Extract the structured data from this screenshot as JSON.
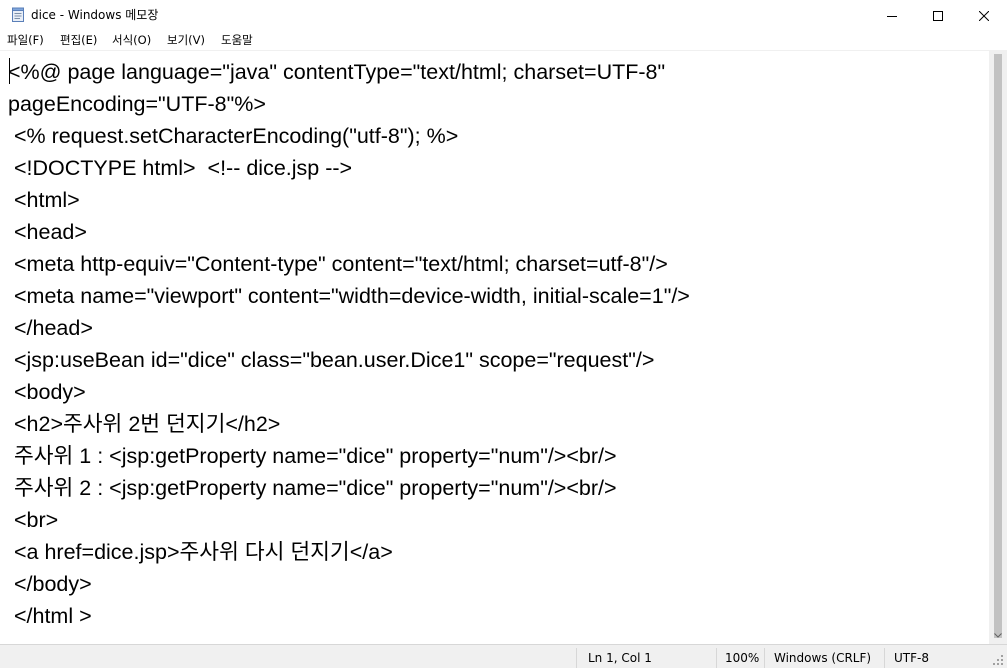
{
  "window": {
    "title": "dice - Windows 메모장"
  },
  "menu": {
    "file": "파일(F)",
    "edit": "편집(E)",
    "format": "서식(O)",
    "view": "보기(V)",
    "help": "도움말"
  },
  "editor": {
    "content": "<%@ page language=\"java\" contentType=\"text/html; charset=UTF-8\"\npageEncoding=\"UTF-8\"%>\n <% request.setCharacterEncoding(\"utf-8\"); %>\n <!DOCTYPE html>  <!-- dice.jsp -->\n <html>\n <head>\n <meta http-equiv=\"Content-type\" content=\"text/html; charset=utf-8\"/>\n <meta name=\"viewport\" content=\"width=device-width, initial-scale=1\"/>\n </head>\n <jsp:useBean id=\"dice\" class=\"bean.user.Dice1\" scope=\"request\"/>\n <body>\n <h2>주사위 2번 던지기</h2>\n 주사위 1 : <jsp:getProperty name=\"dice\" property=\"num\"/><br/>\n 주사위 2 : <jsp:getProperty name=\"dice\" property=\"num\"/><br/>\n <br>\n <a href=dice.jsp>주사위 다시 던지기</a>\n </body>\n </html >"
  },
  "status": {
    "position": "Ln 1, Col 1",
    "zoom": "100%",
    "line_ending": "Windows (CRLF)",
    "encoding": "UTF-8"
  },
  "icons": {
    "app": "notepad-icon",
    "minimize": "minimize-icon",
    "maximize": "maximize-icon",
    "close": "close-icon"
  }
}
